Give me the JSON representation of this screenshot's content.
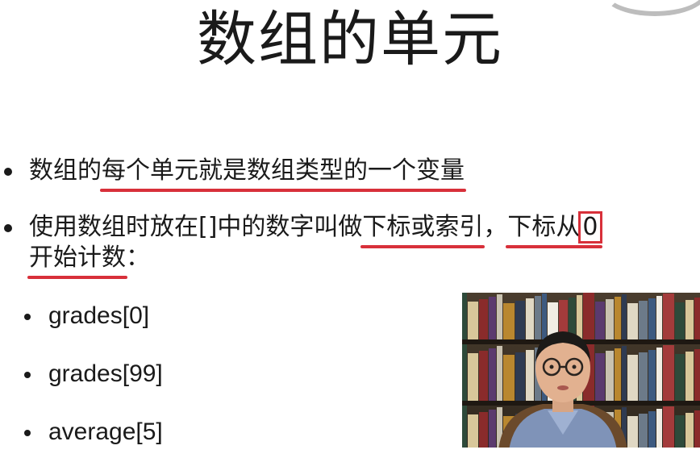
{
  "slide": {
    "title": "数组的单元",
    "bullet1": {
      "text_a": "数组的",
      "text_b": "每个单元就是数组类型的一个变量"
    },
    "bullet2": {
      "text_a": "使用数组时放在[]中的数字叫做",
      "text_b": "下标或索引",
      "text_c": "，",
      "text_d": "下标从",
      "text_e": "0",
      "line2_a": "开始计数",
      "line2_b": "："
    },
    "sub_items": [
      "grades[0]",
      "grades[99]",
      "average[5]"
    ]
  },
  "colors": {
    "text": "#1a1a1a",
    "underline": "#d8303a",
    "background": "#ffffff"
  },
  "video": {
    "icons": [
      "bookshelf",
      "presenter"
    ]
  }
}
